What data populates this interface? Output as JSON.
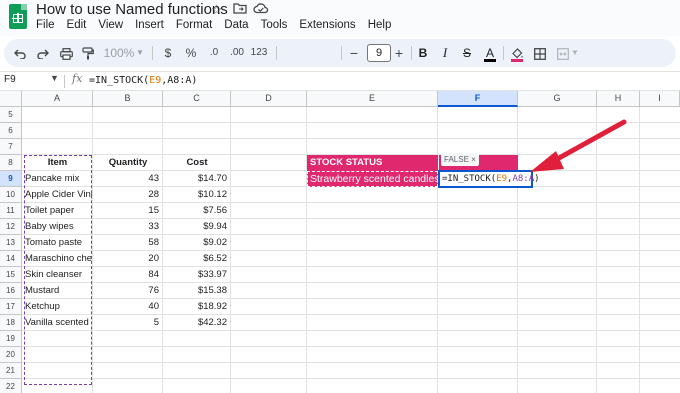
{
  "app": {
    "doc_title": "How to use Named functions",
    "title_icons": [
      "star-icon",
      "move-to-folder-icon",
      "cloud-saved-icon"
    ]
  },
  "menu": [
    "File",
    "Edit",
    "View",
    "Insert",
    "Format",
    "Data",
    "Tools",
    "Extensions",
    "Help"
  ],
  "toolbar": {
    "zoom": "100%",
    "currency": "$",
    "percent": "%",
    "decrease_decimal": ".0",
    "increase_decimal": ".00",
    "number_format": "123",
    "font_size": "9",
    "minus": "−",
    "plus": "+",
    "bold": "B",
    "italic": "I",
    "strikethrough": "S",
    "text_color": "A"
  },
  "formula_bar": {
    "name_box": "F9",
    "fx": "fx",
    "formula_start": "=IN_STOCK(",
    "formula_ref1": "E9",
    "formula_mid": ",A8:A)"
  },
  "columns": [
    "A",
    "B",
    "C",
    "D",
    "E",
    "F",
    "G",
    "H",
    "I"
  ],
  "rows": [
    "5",
    "6",
    "7",
    "8",
    "9",
    "10",
    "11",
    "12",
    "13",
    "14",
    "15",
    "16",
    "17",
    "18",
    "19",
    "20",
    "21",
    "22"
  ],
  "table": {
    "headers": [
      "Item",
      "Quantity",
      "Cost"
    ],
    "items": [
      {
        "item": "Pancake mix",
        "qty": "43",
        "cost": "$14.70"
      },
      {
        "item": "Apple Cider Vine",
        "qty": "28",
        "cost": "$10.12"
      },
      {
        "item": "Toilet paper",
        "qty": "15",
        "cost": "$7.56"
      },
      {
        "item": "Baby wipes",
        "qty": "33",
        "cost": "$9.94"
      },
      {
        "item": "Tomato paste",
        "qty": "58",
        "cost": "$9.02"
      },
      {
        "item": "Maraschino che",
        "qty": "20",
        "cost": "$6.52"
      },
      {
        "item": "Skin cleanser",
        "qty": "84",
        "cost": "$33.97"
      },
      {
        "item": "Mustard",
        "qty": "76",
        "cost": "$15.38"
      },
      {
        "item": "Ketchup",
        "qty": "40",
        "cost": "$18.92"
      },
      {
        "item": "Vanilla scented c",
        "qty": "5",
        "cost": "$42.32"
      }
    ]
  },
  "status": {
    "header": "STOCK STATUS",
    "item": "Strawberry scented candles",
    "chip": "FALSE",
    "chip_close": "×",
    "formula_start": "=IN_STOCK(",
    "formula_ref1": "E9",
    "formula_sep": ",",
    "formula_ref2": "A8:A",
    "formula_end": ")"
  },
  "colors": {
    "status_fill": "#e0286e",
    "selection": "#0b57d0",
    "range_highlight": "#7a3ea8",
    "arrow": "#e0203a"
  }
}
